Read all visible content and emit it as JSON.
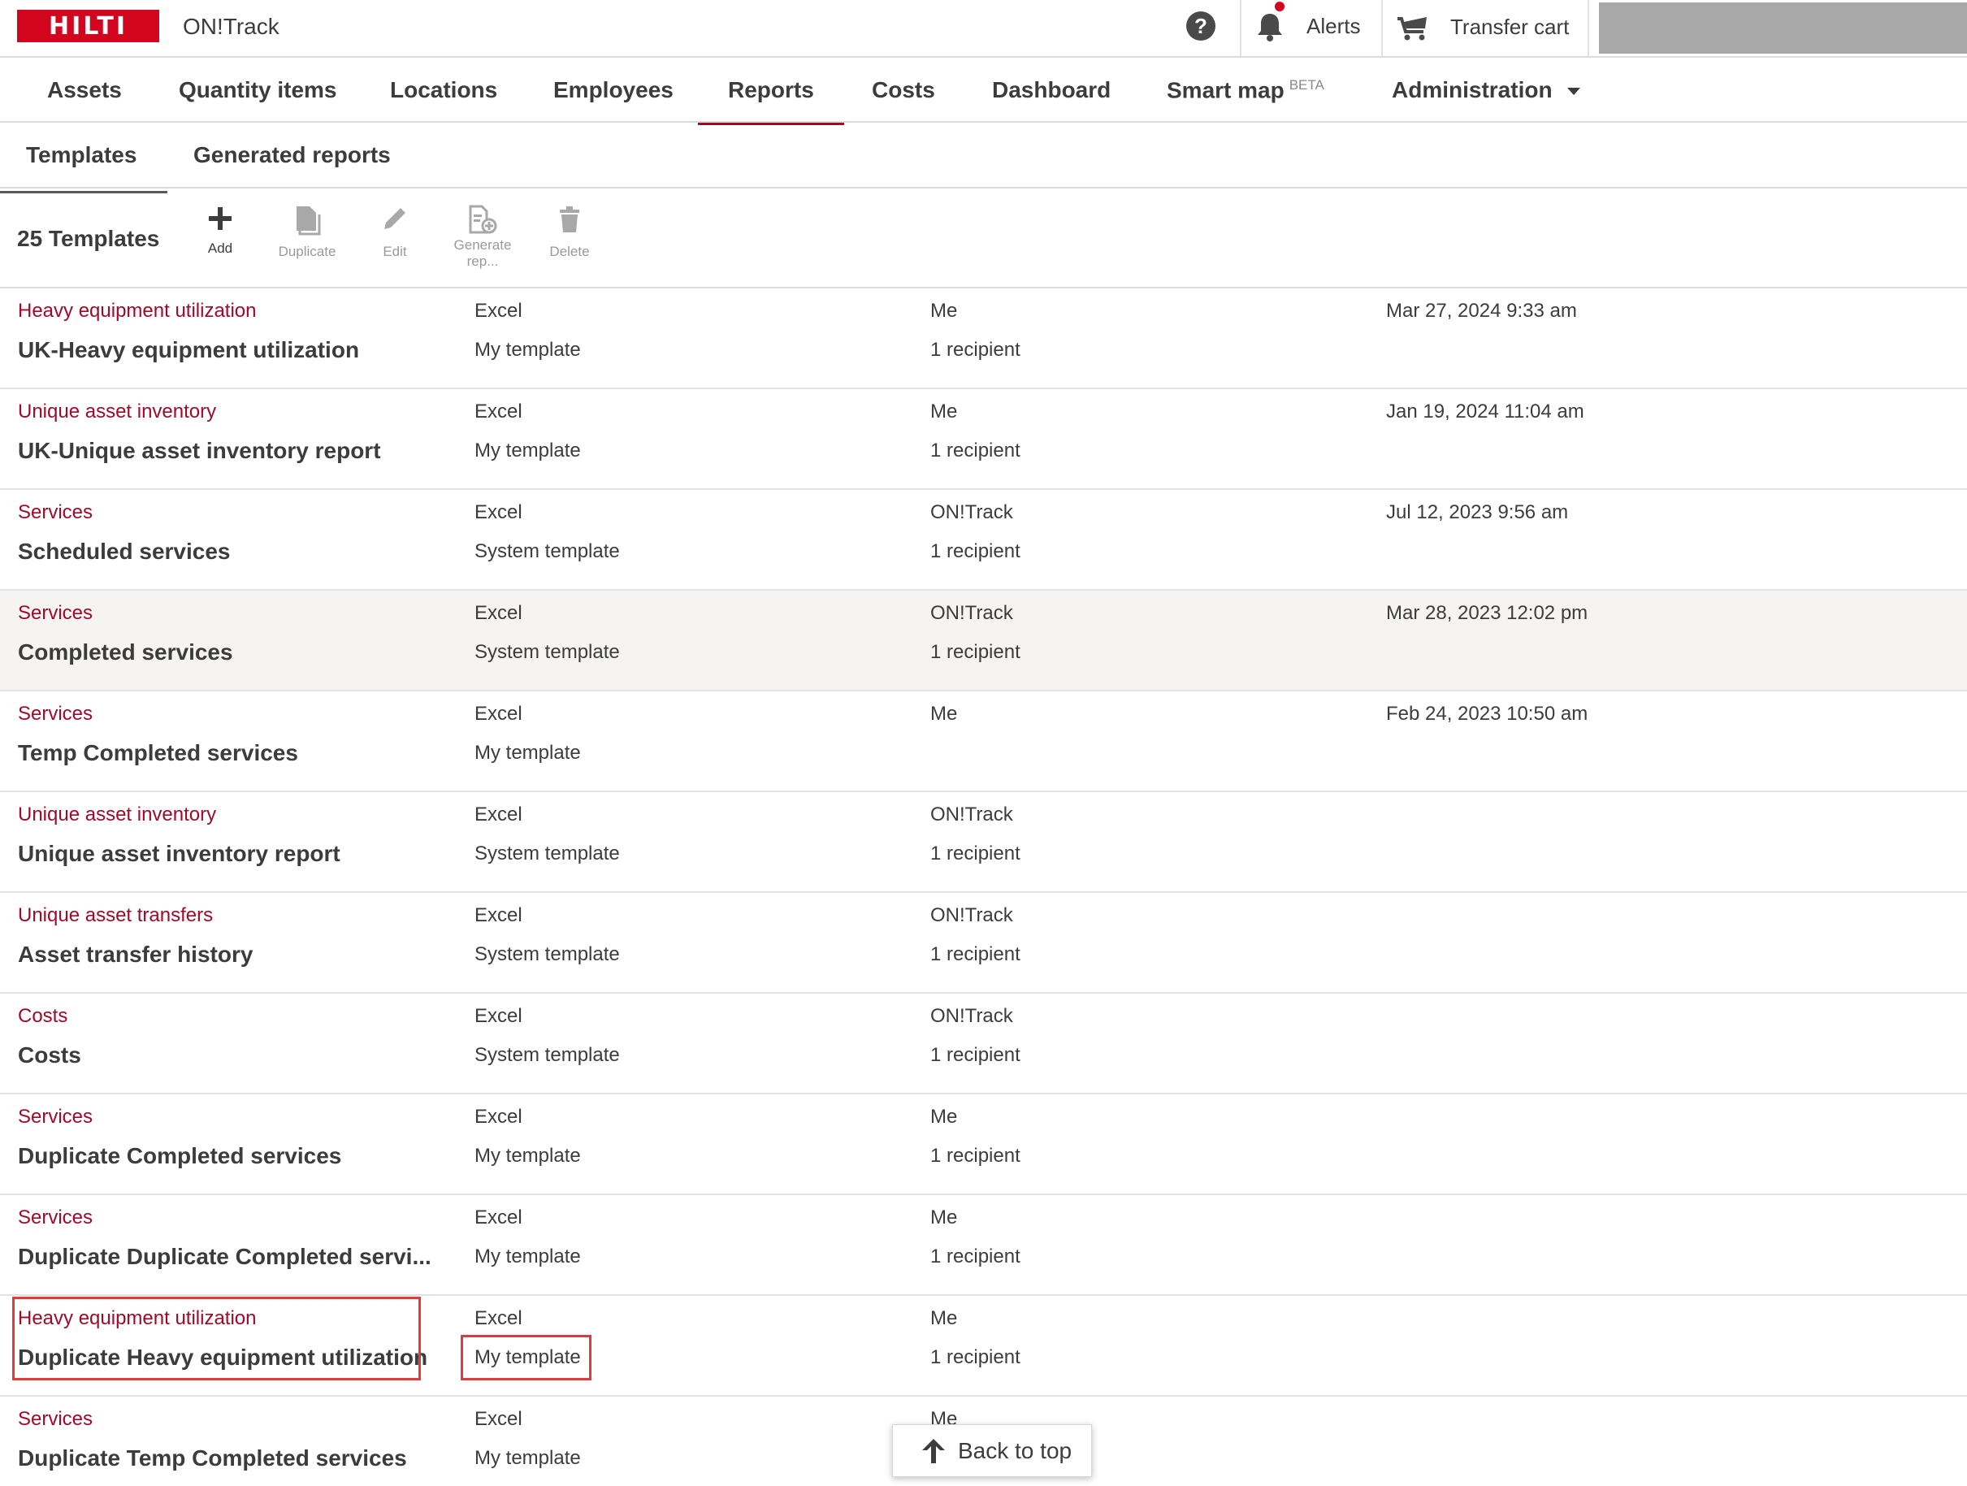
{
  "header": {
    "brand": "HILTI",
    "app_name": "ON!Track",
    "alerts_label": "Alerts",
    "cart_label": "Transfer cart",
    "colors": {
      "brand_red": "#d2051e",
      "accent": "#a00a28"
    }
  },
  "nav": {
    "items": [
      {
        "label": "Assets"
      },
      {
        "label": "Quantity items"
      },
      {
        "label": "Locations"
      },
      {
        "label": "Employees"
      },
      {
        "label": "Reports",
        "active": true
      },
      {
        "label": "Costs"
      },
      {
        "label": "Dashboard"
      },
      {
        "label": "Smart map",
        "badge": "BETA"
      },
      {
        "label": "Administration"
      }
    ]
  },
  "subtabs": [
    {
      "label": "Templates",
      "active": true
    },
    {
      "label": "Generated reports"
    }
  ],
  "toolbar": {
    "count_label": "25 Templates",
    "actions": [
      {
        "label": "Add",
        "icon": "plus-icon",
        "enabled": true
      },
      {
        "label": "Duplicate",
        "icon": "duplicate-icon",
        "enabled": false
      },
      {
        "label": "Edit",
        "icon": "pencil-icon",
        "enabled": false
      },
      {
        "label": "Generate rep...",
        "icon": "generate-report-icon",
        "enabled": false
      },
      {
        "label": "Delete",
        "icon": "trash-icon",
        "enabled": false
      }
    ]
  },
  "templates": [
    {
      "type": "Heavy equipment utilization",
      "name": "UK-Heavy equipment utilization",
      "format": "Excel",
      "kind": "My template",
      "owner": "Me",
      "recipients": "1 recipient",
      "date": "Mar 27, 2024 9:33 am"
    },
    {
      "type": "Unique asset inventory",
      "name": "UK-Unique asset inventory report",
      "format": "Excel",
      "kind": "My template",
      "owner": "Me",
      "recipients": "1 recipient",
      "date": "Jan 19, 2024 11:04 am"
    },
    {
      "type": "Services",
      "name": "Scheduled services",
      "format": "Excel",
      "kind": "System template",
      "owner": "ON!Track",
      "recipients": "1 recipient",
      "date": "Jul 12, 2023 9:56 am"
    },
    {
      "type": "Services",
      "name": "Completed services",
      "format": "Excel",
      "kind": "System template",
      "owner": "ON!Track",
      "recipients": "1 recipient",
      "date": "Mar 28, 2023 12:02 pm",
      "highlighted": true
    },
    {
      "type": "Services",
      "name": "Temp Completed services",
      "format": "Excel",
      "kind": "My template",
      "owner": "Me",
      "recipients": "",
      "date": "Feb 24, 2023 10:50 am"
    },
    {
      "type": "Unique asset inventory",
      "name": "Unique asset inventory report",
      "format": "Excel",
      "kind": "System template",
      "owner": "ON!Track",
      "recipients": "1 recipient",
      "date": ""
    },
    {
      "type": "Unique asset transfers",
      "name": "Asset transfer history",
      "format": "Excel",
      "kind": "System template",
      "owner": "ON!Track",
      "recipients": "1 recipient",
      "date": ""
    },
    {
      "type": "Costs",
      "name": "Costs",
      "format": "Excel",
      "kind": "System template",
      "owner": "ON!Track",
      "recipients": "1 recipient",
      "date": ""
    },
    {
      "type": "Services",
      "name": "Duplicate Completed services",
      "format": "Excel",
      "kind": "My template",
      "owner": "Me",
      "recipients": "1 recipient",
      "date": ""
    },
    {
      "type": "Services",
      "name": "Duplicate Duplicate Completed servi...",
      "format": "Excel",
      "kind": "My template",
      "owner": "Me",
      "recipients": "1 recipient",
      "date": ""
    },
    {
      "type": "Heavy equipment utilization",
      "name": "Duplicate Heavy equipment utilization",
      "format": "Excel",
      "kind": "My template",
      "owner": "Me",
      "recipients": "1 recipient",
      "date": ""
    },
    {
      "type": "Services",
      "name": "Duplicate Temp Completed services",
      "format": "Excel",
      "kind": "My template",
      "owner": "Me",
      "recipients": "",
      "date": ""
    }
  ],
  "back_to_top_label": "Back to top"
}
